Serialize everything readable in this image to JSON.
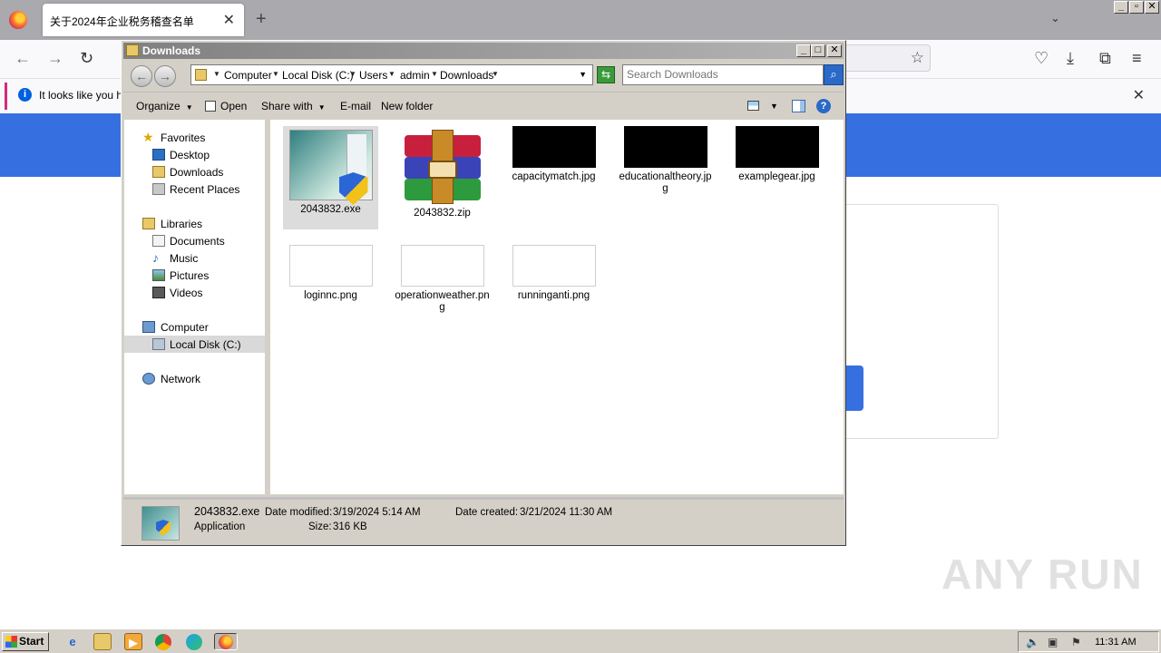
{
  "browser": {
    "tab_title": "关于2024年企业税务稽查名单",
    "tab_close": "✕",
    "new_tab": "+",
    "notification_text": "It looks like you ha",
    "notification_close": "✕"
  },
  "explorer": {
    "title": "Downloads",
    "breadcrumbs": [
      "Computer",
      "Local Disk (C:)",
      "Users",
      "admin",
      "Downloads"
    ],
    "search_placeholder": "Search Downloads",
    "toolbar": {
      "organize": "Organize",
      "open": "Open",
      "share_with": "Share with",
      "email": "E-mail",
      "new_folder": "New folder"
    },
    "nav": {
      "favorites": "Favorites",
      "desktop": "Desktop",
      "downloads": "Downloads",
      "recent_places": "Recent Places",
      "libraries": "Libraries",
      "documents": "Documents",
      "music": "Music",
      "pictures": "Pictures",
      "videos": "Videos",
      "computer": "Computer",
      "local_disk": "Local Disk (C:)",
      "network": "Network"
    },
    "files": [
      {
        "name": "2043832.exe",
        "kind": "exe",
        "selected": true
      },
      {
        "name": "2043832.zip",
        "kind": "zip"
      },
      {
        "name": "capacitymatch.jpg",
        "kind": "image-black"
      },
      {
        "name": "educationaltheory.jpg",
        "kind": "image-black"
      },
      {
        "name": "examplegear.jpg",
        "kind": "image-black"
      },
      {
        "name": "loginnc.png",
        "kind": "image-white"
      },
      {
        "name": "operationweather.png",
        "kind": "image-white"
      },
      {
        "name": "runninganti.png",
        "kind": "image-white"
      }
    ],
    "details": {
      "name": "2043832.exe",
      "type": "Application",
      "date_modified_label": "Date modified:",
      "date_modified": "3/19/2024 5:14 AM",
      "size_label": "Size:",
      "size": "316 KB",
      "date_created_label": "Date created:",
      "date_created": "3/21/2024 11:30 AM"
    }
  },
  "taskbar": {
    "start": "Start",
    "clock": "11:31 AM"
  },
  "watermark": "ANY RUN"
}
